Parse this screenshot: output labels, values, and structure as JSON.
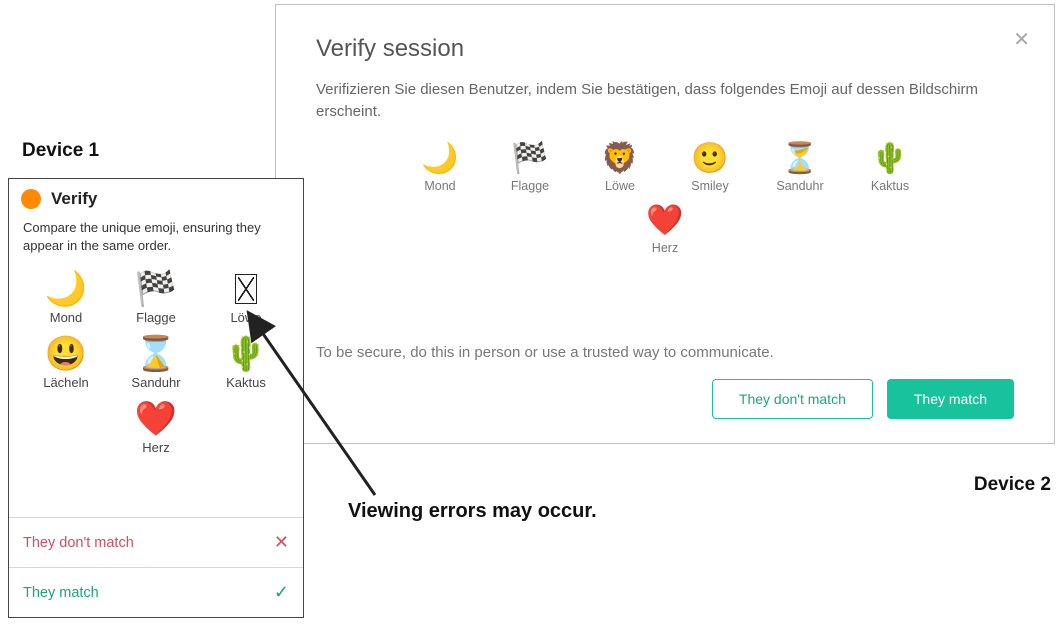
{
  "labels": {
    "device1": "Device 1",
    "device2": "Device 2",
    "caption": "Viewing errors may occur."
  },
  "device1": {
    "title": "Verify",
    "instruction": "Compare the unique emoji, ensuring they appear in the same order.",
    "emojis": [
      {
        "name": "Mond",
        "glyph": "🌙"
      },
      {
        "name": "Flagge",
        "glyph": "🏁"
      },
      {
        "name": "Löwe",
        "glyph": "missing"
      },
      {
        "name": "Lächeln",
        "glyph": "😃"
      },
      {
        "name": "Sanduhr",
        "glyph": "⌛"
      },
      {
        "name": "Kaktus",
        "glyph": "🌵"
      },
      {
        "name": "Herz",
        "glyph": "❤️"
      }
    ],
    "actions": {
      "nomatch": "They don't match",
      "match": "They match"
    }
  },
  "device2": {
    "title": "Verify session",
    "instruction": "Verifizieren Sie diesen Benutzer, indem Sie bestätigen, dass folgendes Emoji auf dessen Bildschirm erscheint.",
    "emojis": [
      {
        "name": "Mond",
        "glyph": "🌙"
      },
      {
        "name": "Flagge",
        "glyph": "🏁"
      },
      {
        "name": "Löwe",
        "glyph": "🦁"
      },
      {
        "name": "Smiley",
        "glyph": "🙂"
      },
      {
        "name": "Sanduhr",
        "glyph": "⏳"
      },
      {
        "name": "Kaktus",
        "glyph": "🌵"
      },
      {
        "name": "Herz",
        "glyph": "❤️"
      }
    ],
    "note": "To be secure, do this in person or use a trusted way to communicate.",
    "buttons": {
      "nomatch": "They don't match",
      "match": "They match"
    }
  }
}
